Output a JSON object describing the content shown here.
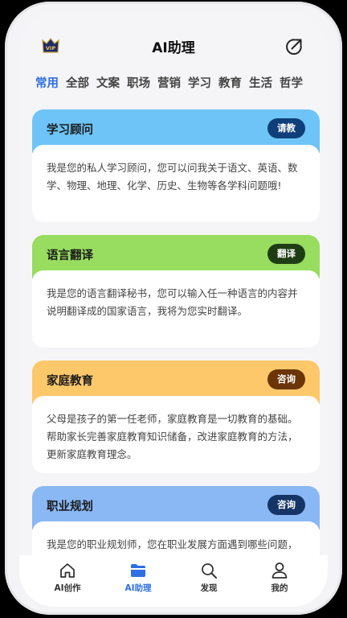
{
  "header": {
    "title": "AI助理",
    "vip_badge": "VIP"
  },
  "tabs": [
    {
      "label": "常用",
      "active": true
    },
    {
      "label": "全部"
    },
    {
      "label": "文案"
    },
    {
      "label": "职场"
    },
    {
      "label": "营销"
    },
    {
      "label": "学习"
    },
    {
      "label": "教育"
    },
    {
      "label": "生活"
    },
    {
      "label": "哲学"
    }
  ],
  "cards": [
    {
      "title": "学习顾问",
      "button": "请教",
      "text": "我是您的私人学习顾问，您可以问我关于语文、英语、数学、物理、地理、化学、历史、生物等各学科问题哦!",
      "head_color": "#6ec4f7",
      "button_color": "#0f3f7a"
    },
    {
      "title": "语言翻译",
      "button": "翻译",
      "text": "我是您的语言翻译秘书，您可以输入任一种语言的内容并说明翻译成的国家语言，我将为您实时翻译。",
      "head_color": "#98dd5f",
      "button_color": "#1f3d14"
    },
    {
      "title": "家庭教育",
      "button": "咨询",
      "text": "父母是孩子的第一任老师，家庭教育是一切教育的基础。帮助家长完善家庭教育知识储备，改进家庭教育的方法，更新家庭教育理念。",
      "head_color": "#fdc86a",
      "button_color": "#6b3508"
    },
    {
      "title": "职业规划",
      "button": "咨询",
      "text": "我是您的职业规划师，您在职业发展方面遇到哪些问题，我帮您分析规划!",
      "head_color": "#8ab8f5",
      "button_color": "#153566"
    }
  ],
  "nav": [
    {
      "label": "AI创作",
      "icon": "home-icon"
    },
    {
      "label": "AI助理",
      "icon": "folder-icon",
      "active": true
    },
    {
      "label": "发现",
      "icon": "search-icon"
    },
    {
      "label": "我的",
      "icon": "profile-icon"
    }
  ],
  "colors": {
    "accent": "#2f6fe4"
  }
}
